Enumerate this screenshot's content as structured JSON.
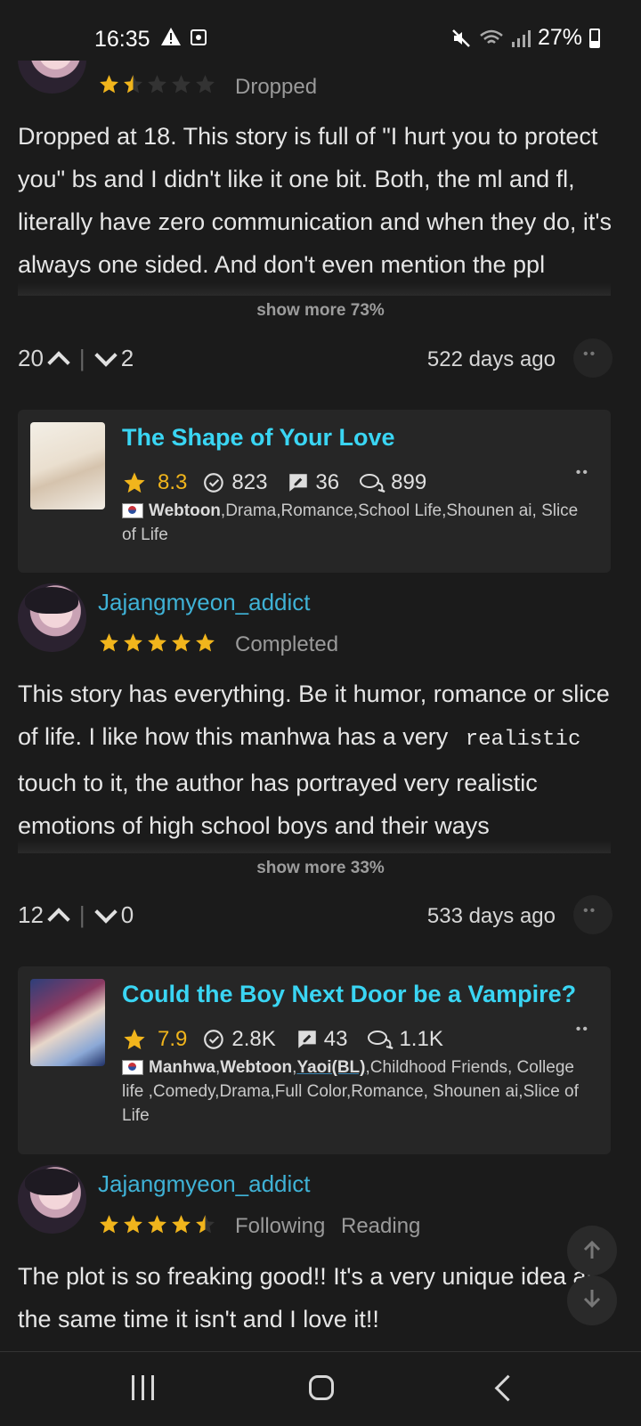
{
  "status_bar": {
    "time": "16:35",
    "battery": "27%"
  },
  "reviews": [
    {
      "status": "Dropped",
      "rating": 1.5,
      "text": "Dropped at 18. This story is full of \"I hurt you to protect you\" bs and I didn't like it one bit. Both, the ml and fl, literally have zero communication and when they do, it's always one sided. And don't even mention the ppl",
      "show_more": "show more 73%",
      "upvotes": "20",
      "downvotes": "2",
      "age": "522 days ago"
    },
    {
      "username": "Jajangmyeon_addict",
      "status": "Completed",
      "rating": 5,
      "text_part1": "This story has everything. Be it humor, romance or slice of life. I like how this manhwa has a very ",
      "text_code": "realistic",
      "text_part2": " touch to it, the author has portrayed very realistic emotions of high school boys and their ways",
      "show_more": "show more 33%",
      "upvotes": "12",
      "downvotes": "0",
      "age": "533 days ago"
    },
    {
      "username": "Jajangmyeon_addict",
      "status1": "Following",
      "status2": "Reading",
      "rating": 4.5,
      "text": "The plot is so freaking good!! It's a very unique idea at the same time it isn't and I love it!!"
    }
  ],
  "cards": [
    {
      "title": "The Shape of Your Love",
      "rating": "8.3",
      "reads": "823",
      "reviews": "36",
      "comments": "899",
      "tags_bold": "Webtoon",
      "tags_rest": ",Drama,Romance,School Life,Shounen ai, Slice of Life"
    },
    {
      "title": "Could the Boy Next Door be a Vampire?",
      "rating": "7.9",
      "reads": "2.8K",
      "reviews": "43",
      "comments": "1.1K",
      "tags_bold1": "Manhwa",
      "tags_bold2": "Webtoon",
      "tags_link": "Yaoi(BL)",
      "tags_rest": ",Childhood Friends, College life ,Comedy,Drama,Full Color,Romance, Shounen ai,Slice of Life"
    }
  ],
  "colors": {
    "accent": "#3ad5f3",
    "username": "#3fb2d6",
    "star": "#f1b51c",
    "background": "#1b1b1b"
  },
  "icons": [
    "warning-icon",
    "photo-icon",
    "mute-icon",
    "wifi-icon",
    "signal-icon",
    "battery-icon",
    "star-icon",
    "check-icon",
    "review-icon",
    "comment-icon",
    "arrow-up-icon",
    "arrow-down-icon",
    "more-icon"
  ]
}
